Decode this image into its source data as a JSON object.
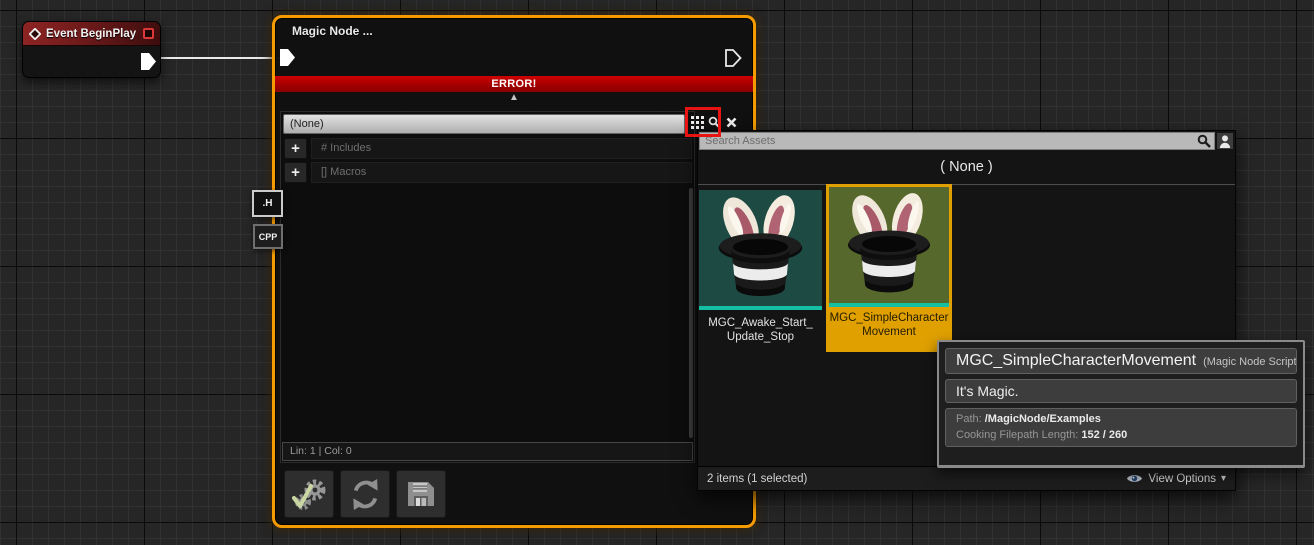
{
  "colors": {
    "selection_orange": "#F59B00",
    "error_red": "#AD0000",
    "annotation_red": "#E81313",
    "teal_accent": "#15BFA4",
    "selected_tile_orange": "#DFA000",
    "event_header_red": "#7E1F1F"
  },
  "icons": {
    "collapse": "▲",
    "caret_down": "▾",
    "plus": "+"
  },
  "graph": {
    "event_node": {
      "title": "Event BeginPlay"
    },
    "magic_node": {
      "title": "Magic Node ...",
      "error_label": "ERROR!",
      "dropdown_value": "(None)",
      "include_row_label": "# Includes",
      "macro_row_label": "[] Macros",
      "status_line": "Lin: 1  |  Col: 0",
      "tab_h": ".H",
      "tab_cpp": "CPP"
    }
  },
  "asset_picker": {
    "search_placeholder": "Search Assets",
    "none_label": "( None )",
    "assets": [
      {
        "line1": "MGC_Awake_Start_",
        "line2": "Update_Stop",
        "selected": false
      },
      {
        "line1": "MGC_SimpleCharacter",
        "line2": "Movement",
        "selected": true
      }
    ],
    "footer_items": "2 items (1 selected)",
    "view_options": "View Options"
  },
  "tooltip": {
    "title": "MGC_SimpleCharacterMovement",
    "title_suffix": "(Magic Node Script)",
    "description": "It's Magic.",
    "path_label": "Path:",
    "path_value": "/MagicNode/Examples",
    "cooking_label": "Cooking Filepath Length:",
    "cooking_value": "152 / 260"
  }
}
